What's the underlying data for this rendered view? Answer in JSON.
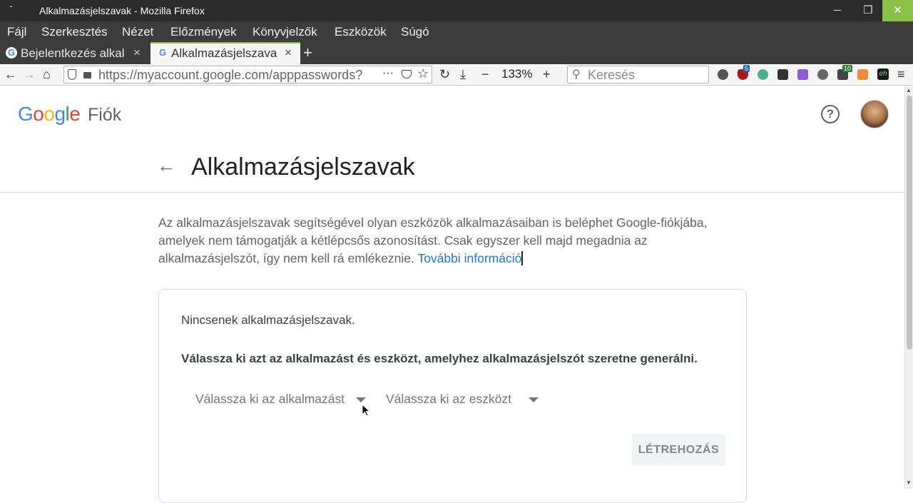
{
  "window": {
    "menu_glyph": "˘",
    "title": "Alkalmazásjelszavak - Mozilla Firefox",
    "minimize": "─",
    "restore": "❐",
    "close": "✕"
  },
  "menubar": {
    "items": [
      "Fájl",
      "Szerkesztés",
      "Nézet",
      "Előzmények",
      "Könyvjelzők",
      "Eszközök",
      "Súgó"
    ]
  },
  "tabs": [
    {
      "label": "Bejelentkezés alkal",
      "close": "×"
    },
    {
      "label": "Alkalmazásjelszava",
      "close": "×"
    }
  ],
  "new_tab": "+",
  "nav": {
    "url": "https://myaccount.google.com/apppasswords?",
    "more": "···",
    "zoom": "133%",
    "zoom_out": "−",
    "zoom_in": "+",
    "search_placeholder": "Keresés",
    "ext_badge_1": "5",
    "ext_badge_2": "10",
    "ext_eh": "eh"
  },
  "header": {
    "logo_letters": [
      "G",
      "o",
      "o",
      "g",
      "l",
      "e"
    ],
    "logo_colors": [
      "#4285f4",
      "#ea4335",
      "#fbbc05",
      "#4285f4",
      "#34a853",
      "#ea4335"
    ],
    "product": "Fiók",
    "help": "?"
  },
  "main": {
    "back": "←",
    "title": "Alkalmazásjelszavak",
    "description": "Az alkalmazásjelszavak segítségével olyan eszközök alkalmazásaiban is beléphet Google-fiókjába, amelyek nem támogatják a kétlépcsős azonosítást. Csak egyszer kell majd megadnia az alkalmazásjelszót, így nem kell rá emlékeznie. ",
    "more_info": "További információ"
  },
  "card": {
    "none_text": "Nincsenek alkalmazásjelszavak.",
    "instruction": "Válassza ki azt az alkalmazást és eszközt, amelyhez alkalmazásjelszót szeretne generálni.",
    "select_app": "Válassza ki az alkalmazást",
    "select_device": "Válassza ki az eszközt",
    "create": "LÉTREHOZÁS"
  },
  "colors": {
    "link": "#1a73e8",
    "accent": "#8bc34a"
  }
}
